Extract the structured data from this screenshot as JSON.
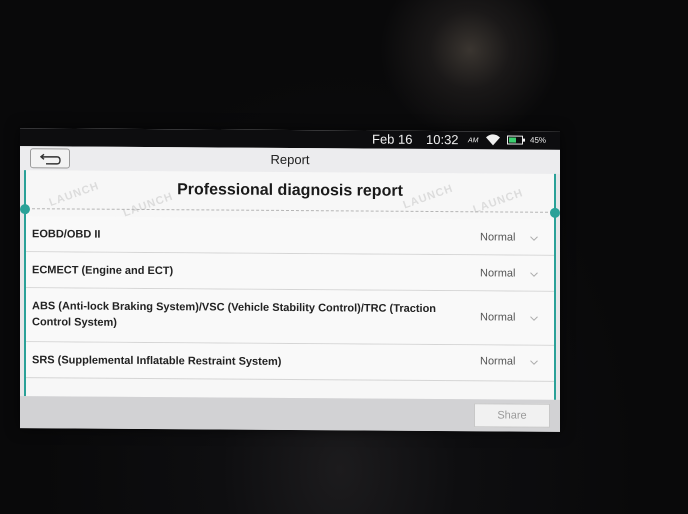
{
  "status_bar": {
    "date": "Feb 16",
    "time": "10:32",
    "ampm": "AM",
    "battery": "45%",
    "icons": [
      "wifi-icon",
      "battery-icon"
    ]
  },
  "header": {
    "title": "Report",
    "back_icon": "back-arrow-icon"
  },
  "report": {
    "heading": "Professional diagnosis report",
    "watermark": "LAUNCH",
    "rows": [
      {
        "label": "EOBD/OBD II",
        "status": "Normal"
      },
      {
        "label": "ECMECT (Engine and ECT)",
        "status": "Normal"
      },
      {
        "label": "ABS (Anti-lock Braking System)/VSC (Vehicle Stability Control)/TRC (Traction Control System)",
        "status": "Normal"
      },
      {
        "label": "SRS (Supplemental Inflatable Restraint System)",
        "status": "Normal"
      }
    ]
  },
  "footer": {
    "share_label": "Share"
  },
  "colors": {
    "accent": "#2aa198",
    "status_bar_bg": "#0d0d0f"
  }
}
